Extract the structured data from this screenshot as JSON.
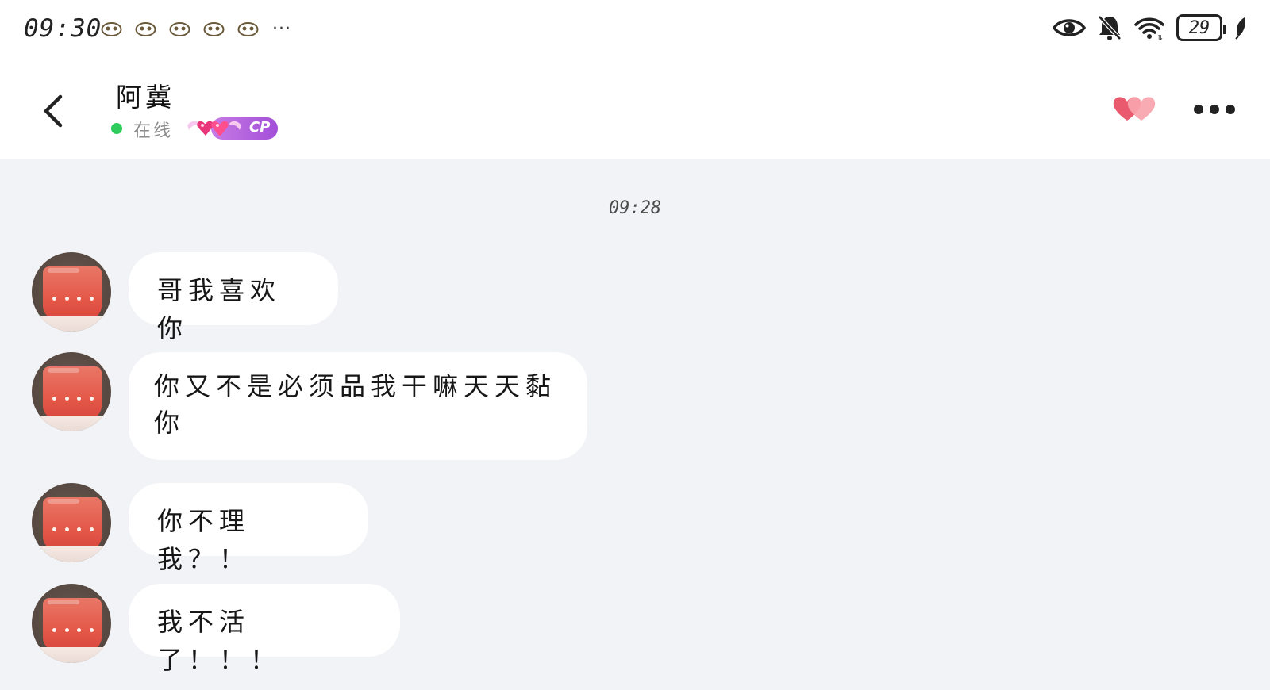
{
  "status_bar": {
    "time": "09:30",
    "notification_icons": [
      "app-notif-icon",
      "app-notif-icon",
      "app-notif-icon",
      "app-notif-icon",
      "app-notif-icon"
    ],
    "more": "···",
    "battery_level": "29",
    "right_icons": [
      "eye-icon",
      "mute-bell-icon",
      "wifi-icon",
      "battery-icon",
      "leaf-icon"
    ]
  },
  "header": {
    "contact_name": "阿冀",
    "status_text": "在线",
    "cp_badge": "CP"
  },
  "chat": {
    "timestamp": "09:28",
    "messages": [
      {
        "sender": "contact",
        "text": "哥我喜欢你"
      },
      {
        "sender": "contact",
        "text": "你又不是必须品我干嘛天天黏你"
      },
      {
        "sender": "contact",
        "text": "你不理我？！"
      },
      {
        "sender": "contact",
        "text": "我不活了！！！"
      }
    ]
  },
  "colors": {
    "online_green": "#2fcc5b",
    "cp_purple": "#a34fd8",
    "heart_pink": "#f06a7a",
    "chat_background": "#f2f3f6",
    "bubble_background": "#ffffff"
  }
}
